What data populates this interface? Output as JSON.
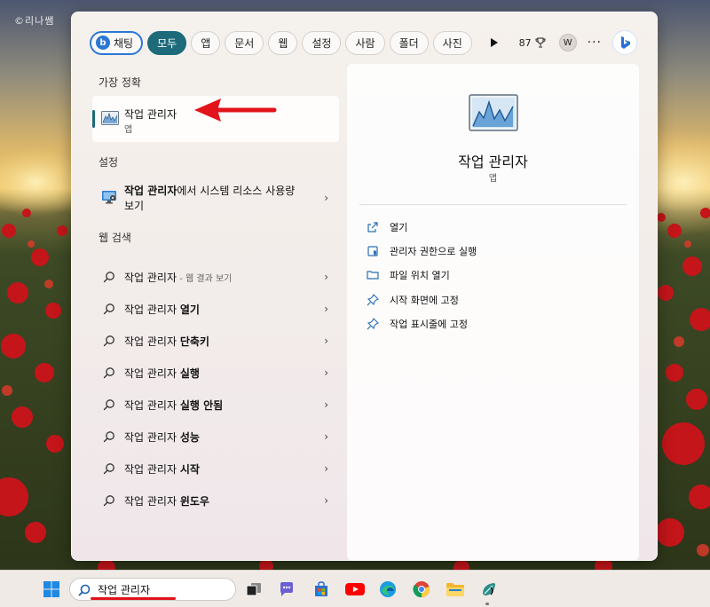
{
  "watermark": "©리나쌤",
  "filters": {
    "chat": "채팅",
    "all": "모두",
    "apps": "앱",
    "documents": "문서",
    "web": "웹",
    "settings": "설정",
    "people": "사람",
    "folders": "폴더",
    "photos": "사진"
  },
  "rewards": {
    "points": "87"
  },
  "account": {
    "initial": "W"
  },
  "more_label": "···",
  "sections": {
    "best_match": "가장 정확",
    "settings": "설정",
    "web_search": "웹 검색"
  },
  "best_match": {
    "title": "작업 관리자",
    "type": "앱"
  },
  "settings_result": {
    "bold": "작업 관리자",
    "rest": "에서 시스템 리소스 사용량 보기"
  },
  "web_results": [
    {
      "base": "작업 관리자",
      "sep": " - ",
      "hint": "웹 결과 보기",
      "bold": ""
    },
    {
      "base": "작업 관리자 ",
      "sep": "",
      "hint": "",
      "bold": "열기"
    },
    {
      "base": "작업 관리자 ",
      "sep": "",
      "hint": "",
      "bold": "단축키"
    },
    {
      "base": "작업 관리자 ",
      "sep": "",
      "hint": "",
      "bold": "실행"
    },
    {
      "base": "작업 관리자 ",
      "sep": "",
      "hint": "",
      "bold": "실행 안됨"
    },
    {
      "base": "작업 관리자 ",
      "sep": "",
      "hint": "",
      "bold": "성능"
    },
    {
      "base": "작업 관리자 ",
      "sep": "",
      "hint": "",
      "bold": "시작"
    },
    {
      "base": "작업 관리자 ",
      "sep": "",
      "hint": "",
      "bold": "윈도우"
    }
  ],
  "preview": {
    "title": "작업 관리자",
    "type": "앱",
    "actions": [
      {
        "label": "열기",
        "icon": "open-icon"
      },
      {
        "label": "관리자 권한으로 실행",
        "icon": "shield-icon"
      },
      {
        "label": "파일 위치 열기",
        "icon": "folder-icon"
      },
      {
        "label": "시작 화면에 고정",
        "icon": "pin-icon"
      },
      {
        "label": "작업 표시줄에 고정",
        "icon": "pin-icon"
      }
    ]
  },
  "taskbar": {
    "search_value": "작업 관리자"
  },
  "colors": {
    "accent": "#1c6a7a",
    "chat_border": "#2c77d6",
    "annotation": "#e2131b"
  }
}
